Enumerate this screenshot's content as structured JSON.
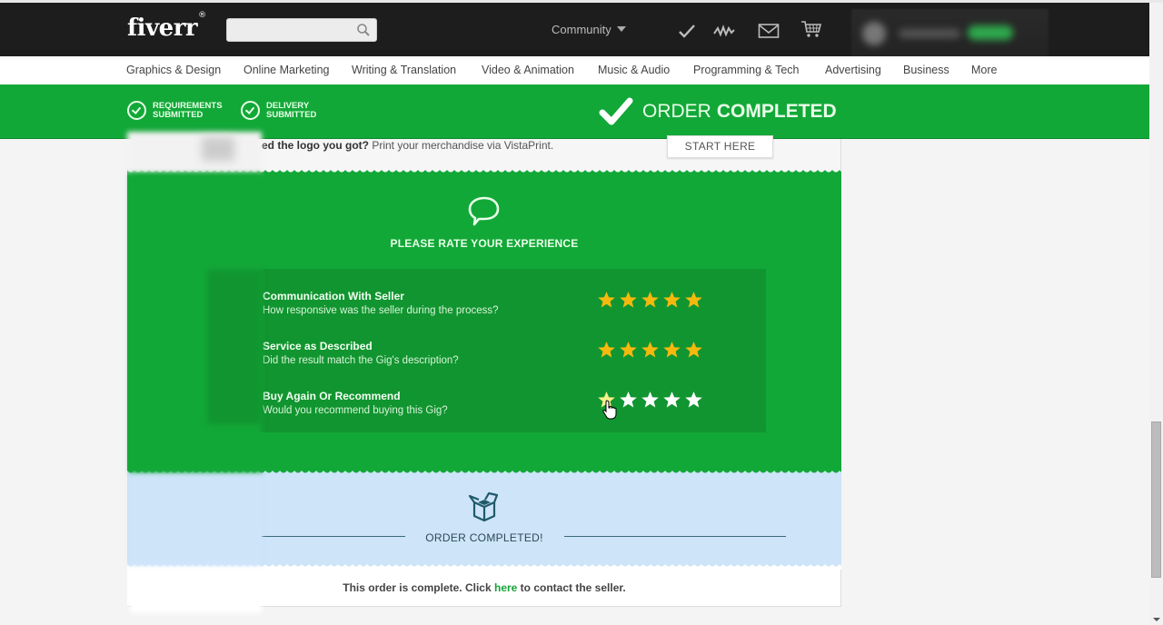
{
  "header": {
    "logo": "fiverr",
    "logo_mark": "®",
    "search": {
      "value": "",
      "placeholder": ""
    },
    "community_label": "Community",
    "icons": [
      "check-icon",
      "activity-icon",
      "mail-icon",
      "cart-icon"
    ]
  },
  "categories": [
    "Graphics & Design",
    "Online Marketing",
    "Writing & Translation",
    "Video & Animation",
    "Music & Audio",
    "Programming & Tech",
    "Advertising",
    "Business",
    "More"
  ],
  "status": {
    "steps": [
      {
        "line1": "REQUIREMENTS",
        "line2": "SUBMITTED"
      },
      {
        "line1": "DELIVERY",
        "line2": "SUBMITTED"
      }
    ],
    "order_title_light": "ORDER",
    "order_title_bold": "COMPLETED",
    "colors": {
      "green": "#12a838",
      "dark_green": "#119530",
      "star": "#f5b90e",
      "done_bg": "#cde4f9"
    }
  },
  "vistaprint": {
    "bold_text": "ed the logo you got?",
    "text": " Print your merchandise via VistaPrint.",
    "button": "START HERE"
  },
  "rating": {
    "title": "PLEASE RATE YOUR EXPERIENCE",
    "criteria": [
      {
        "name": "Communication With Seller",
        "description": "How responsive was the seller during the process?",
        "stars": 5,
        "max": 5
      },
      {
        "name": "Service as Described",
        "description": "Did the result match the Gig's description?",
        "stars": 5,
        "max": 5
      },
      {
        "name": "Buy Again Or Recommend",
        "description": "Would you recommend buying this Gig?",
        "stars": 1,
        "max": 5,
        "hovered": true
      }
    ]
  },
  "completed": {
    "label": "ORDER COMPLETED!",
    "contact_prefix": "This order is complete. Click ",
    "contact_link": "here",
    "contact_suffix": " to contact the seller."
  }
}
